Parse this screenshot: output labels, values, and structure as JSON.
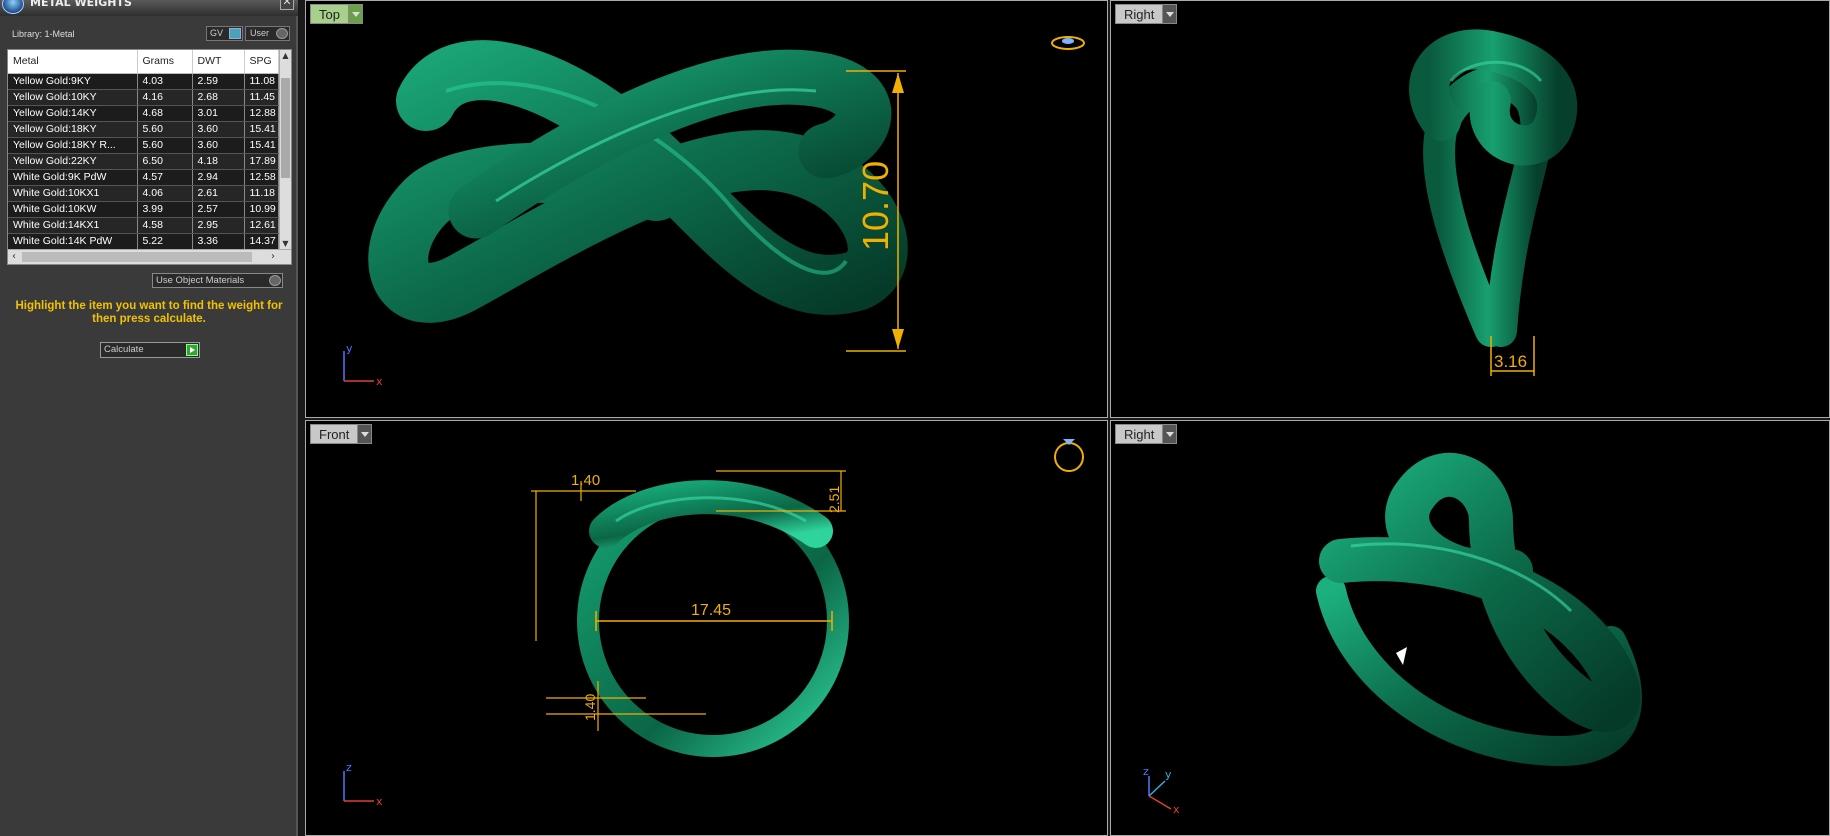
{
  "panel": {
    "title": "METAL WEIGHTS",
    "close_glyph": "✕",
    "library_label": "Library: 1-Metal",
    "gv_label": "GV",
    "user_label": "User",
    "columns": [
      "Metal",
      "Grams",
      "DWT",
      "SPG"
    ],
    "rows": [
      [
        "Yellow Gold:9KY",
        "4.03",
        "2.59",
        "11.08"
      ],
      [
        "Yellow Gold:10KY",
        "4.16",
        "2.68",
        "11.45"
      ],
      [
        "Yellow Gold:14KY",
        "4.68",
        "3.01",
        "12.88"
      ],
      [
        "Yellow Gold:18KY",
        "5.60",
        "3.60",
        "15.41"
      ],
      [
        "Yellow Gold:18KY R...",
        "5.60",
        "3.60",
        "15.41"
      ],
      [
        "Yellow Gold:22KY",
        "6.50",
        "4.18",
        "17.89"
      ],
      [
        "White Gold:9K PdW",
        "4.57",
        "2.94",
        "12.58"
      ],
      [
        "White Gold:10KX1",
        "4.06",
        "2.61",
        "11.18"
      ],
      [
        "White Gold:10KW",
        "3.99",
        "2.57",
        "10.99"
      ],
      [
        "White Gold:14KX1",
        "4.58",
        "2.95",
        "12.61"
      ],
      [
        "White Gold:14K PdW",
        "5.22",
        "3.36",
        "14.37"
      ]
    ],
    "use_object_materials": "Use Object Materials",
    "instructions": "Highlight the item you want to find the weight for then press calculate.",
    "calculate_label": "Calculate"
  },
  "viewports": {
    "top": {
      "label": "Top",
      "dimension": "10.70",
      "axis_1": "y",
      "axis_2": "x"
    },
    "right1": {
      "label": "Right",
      "dimension": "3.16"
    },
    "front": {
      "label": "Front",
      "dim_width": "17.45",
      "dim_top": "1.40",
      "dim_top_right": "2.51",
      "dim_bottom": "1.40",
      "axis_1": "z",
      "axis_2": "x"
    },
    "right2": {
      "label": "Right",
      "axis_1": "z",
      "axis_2": "y",
      "axis_3": "x"
    }
  },
  "colors": {
    "ring": "#0d6e4d",
    "dimension": "#f0b000",
    "active_tab": "#a7d08a"
  },
  "icons": [
    "close-icon",
    "ring-icon",
    "chevron-down-icon",
    "play-icon"
  ]
}
